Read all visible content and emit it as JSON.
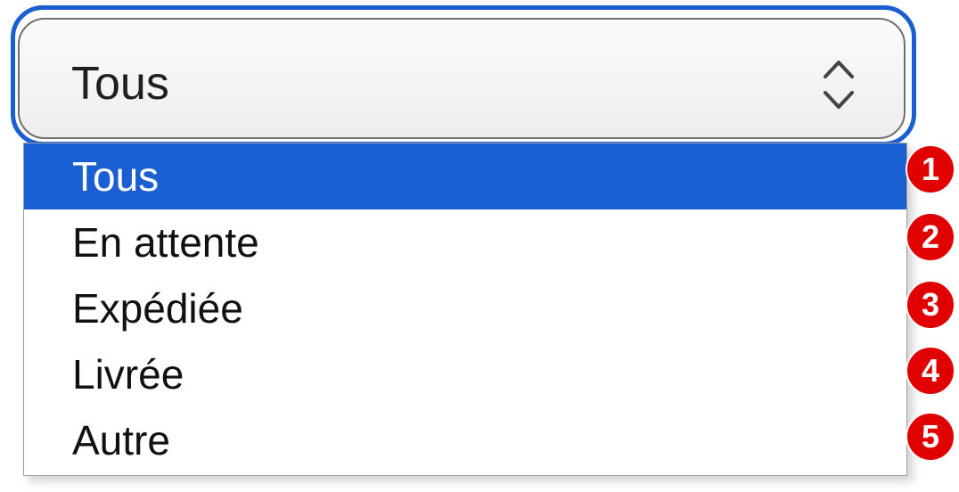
{
  "select": {
    "value": "Tous",
    "accent_color": "#1a5fd1",
    "arrows_icon": "up-down-chevron-icon"
  },
  "dropdown": {
    "options": [
      {
        "label": "Tous",
        "selected": true,
        "badge": "1"
      },
      {
        "label": "En attente",
        "selected": false,
        "badge": "2"
      },
      {
        "label": "Expédiée",
        "selected": false,
        "badge": "3"
      },
      {
        "label": "Livrée",
        "selected": false,
        "badge": "4"
      },
      {
        "label": "Autre",
        "selected": false,
        "badge": "5"
      }
    ],
    "highlight_color": "#1a5fd1",
    "badge_color": "#e00000"
  }
}
